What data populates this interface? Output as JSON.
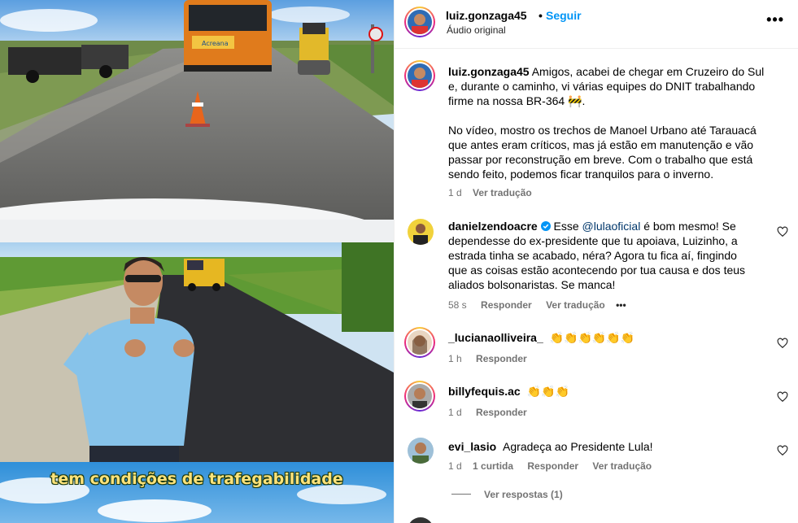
{
  "post": {
    "username": "luiz.gonzaga45",
    "follow_label": "Seguir",
    "audio_label": "Áudio original",
    "more_icon": "more-dots-icon",
    "caption_lines": [
      "Amigos, acabei de chegar em Cruzeiro do Sul",
      "e, durante o caminho, vi várias equipes do DNIT trabalhando",
      "firme na nossa BR-364 🚧."
    ],
    "caption_paragraph2_lines": [
      "No vídeo, mostro os trechos de Manoel Urbano até Tarauacá",
      "que antes eram críticos, mas já estão em manutenção e vão",
      "passar por reconstrução em breve. Com o trabalho que está",
      "sendo feito, podemos ficar tranquilos para o inverno."
    ],
    "time": "1 d",
    "translate_label": "Ver tradução"
  },
  "video": {
    "subtitle": "tem condições de trafegabilidade",
    "bus_text": "Acreana"
  },
  "comments": [
    {
      "username": "danielzendoacre",
      "verified": true,
      "mention": "@lulaoficial",
      "lines": [
        "Esse ",
        " é bom mesmo! Se",
        "dependesse do ex-presidente que tu apoiava, Luizinho, a",
        "estrada tinha se acabado, néra? Agora tu fica aí, fingindo",
        "que as coisas estão acontecendo por tua causa e dos teus",
        "aliados bolsonaristas. Se manca!"
      ],
      "time": "58 s",
      "reply": "Responder",
      "translate": "Ver tradução",
      "more": "•••"
    },
    {
      "username": "_lucianaolliveira_",
      "text": "👏👏👏👏👏👏",
      "time": "1 h",
      "reply": "Responder"
    },
    {
      "username": "billyfequis.ac",
      "text": "👏👏👏",
      "time": "1 d",
      "reply": "Responder"
    },
    {
      "username": "evi_lasio",
      "text": "Agradeça ao Presidente Lula!",
      "time": "1 d",
      "likes": "1 curtida",
      "reply": "Responder",
      "translate": "Ver tradução"
    }
  ],
  "replies": {
    "label": "Ver respostas (1)"
  },
  "colors": {
    "link": "#0095f6",
    "muted": "#737373",
    "ring": "#ee2a7b"
  }
}
